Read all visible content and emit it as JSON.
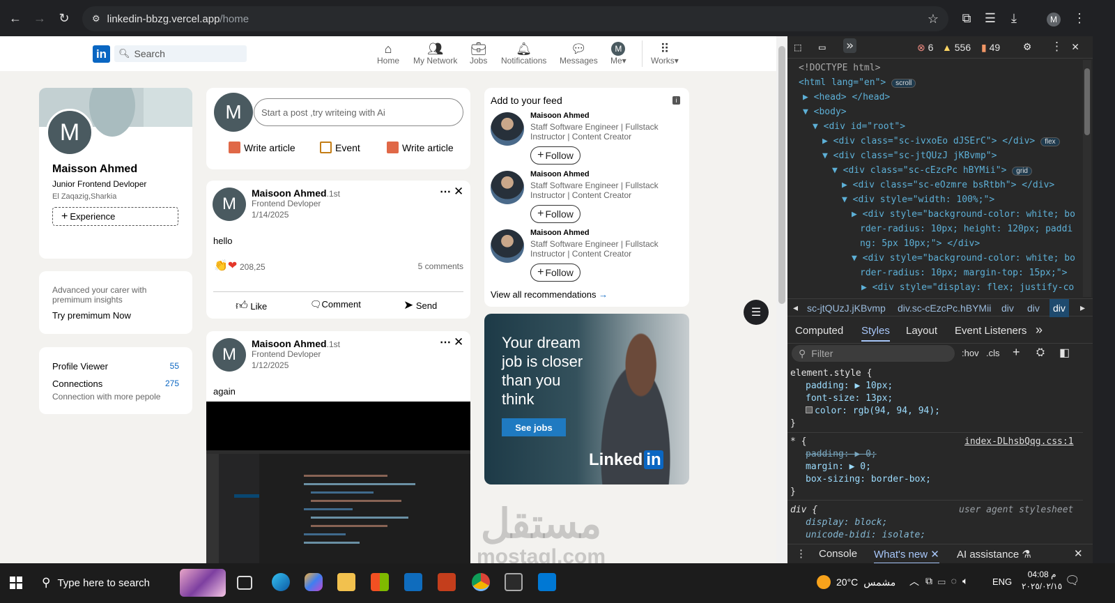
{
  "browser": {
    "url_host": "linkedin-bbzg.vercel.app",
    "url_path": "/home",
    "profile_initial": "M"
  },
  "header": {
    "logo": "in",
    "search_placeholder": "Search",
    "nav": [
      {
        "label": "Home",
        "icon": "home-icon"
      },
      {
        "label": "My Network",
        "icon": "network-icon"
      },
      {
        "label": "Jobs",
        "icon": "briefcase-icon"
      },
      {
        "label": "Notifications",
        "icon": "bell-icon"
      },
      {
        "label": "Messages",
        "icon": "chat-icon"
      },
      {
        "label": "Me",
        "icon": "avatar"
      },
      {
        "label": "Works",
        "icon": "grid-icon"
      }
    ],
    "me_initial": "M"
  },
  "profile": {
    "initial": "M",
    "name": "Maisson Ahmed",
    "title": "Junior Frontend Devloper",
    "location": "El Zaqazig,Sharkia",
    "experience_button": "Experience"
  },
  "premium": {
    "text": "Advanced your carer with premimum insights",
    "link": "Try premimum Now"
  },
  "stats": {
    "profile_viewer_label": "Profile Viewer",
    "profile_viewer_value": "55",
    "connections_label": "Connections",
    "connections_value": "275",
    "connections_sub": "Connection with more pepole"
  },
  "composer": {
    "initial": "M",
    "placeholder": "Start a post ,try writeing with Ai",
    "actions": [
      "Write article",
      "Event",
      "Write article"
    ]
  },
  "posts": [
    {
      "initial": "M",
      "author": "Maisoon Ahmed",
      "degree": ".1st",
      "role": "Frontend Devloper",
      "date": "1/14/2025",
      "text": "hello",
      "reactions": "208,25",
      "comments": "5 comments",
      "actions": [
        "Like",
        "Comment",
        "Send"
      ]
    },
    {
      "initial": "M",
      "author": "Maisoon Ahmed",
      "degree": ".1st",
      "role": "Frontend Devloper",
      "date": "1/12/2025",
      "text": "again"
    }
  ],
  "feed": {
    "title": "Add to your feed",
    "recommendations": [
      {
        "name": "Maisoon Ahmed",
        "headline1": "Staff Software Engineer | Fullstack",
        "headline2": "Instructor | Content Creator",
        "button": "Follow"
      },
      {
        "name": "Maisoon Ahmed",
        "headline1": "Staff Software Engineer | Fullstack",
        "headline2": "Instructor | Content Creator",
        "button": "Follow"
      },
      {
        "name": "Maisoon Ahmed",
        "headline1": "Staff Software Engineer | Fullstack",
        "headline2": "Instructor | Content Creator",
        "button": "Follow"
      }
    ],
    "view_all": "View all recommendations"
  },
  "ad": {
    "line1": "Your dream",
    "line2": "job is closer",
    "line3": "than you",
    "line4": "think",
    "button": "See jobs",
    "brand": "Linked"
  },
  "devtools": {
    "errors": "6",
    "warnings": "556",
    "issues": "49",
    "tree": [
      "<!DOCTYPE html>",
      "<html lang=\"en\">",
      "<head> </head>",
      "<body>",
      "<div id=\"root\">",
      "<div class=\"sc-ivxoEo dJSErC\"> </div>",
      "<div class=\"sc-jtQUzJ jKBvmp\">",
      "<div class=\"sc-cEzcPc hBYMii\">",
      "<div class=\"sc-eOzmre bsRtbh\"> </div>",
      "<div style=\"width: 100%;\">",
      "<div style=\"background-color: white; bo",
      "rder-radius: 10px; height: 120px; paddi",
      "ng: 5px 10px;\"> </div>",
      "<div style=\"background-color: white; bo",
      "rder-radius: 10px; margin-top: 15px;\">",
      "<div style=\"display: flex; justify-co"
    ],
    "badges": {
      "scroll": "scroll",
      "flex": "flex",
      "grid": "grid"
    },
    "breadcrumbs": [
      "sc-jtQUzJ.jKBvmp",
      "div.sc-cEzcPc.hBYMii",
      "div",
      "div",
      "div"
    ],
    "panel_tabs": [
      "Computed",
      "Styles",
      "Layout",
      "Event Listeners"
    ],
    "filter_placeholder": "Filter",
    "filter_tools": [
      ":hov",
      ".cls"
    ],
    "styles": {
      "element_selector": "element.style {",
      "element_rules": [
        "padding: ▶ 10px;",
        "font-size: 13px;",
        "color: rgb(94, 94, 94);"
      ],
      "star_selector": "* {",
      "star_source": "index-DLhsbQqg.css:1",
      "star_rules": [
        "padding: ▶ 0;",
        "margin: ▶ 0;",
        "box-sizing: border-box;"
      ],
      "div_selector": "div {",
      "div_source": "user agent stylesheet",
      "div_rules": [
        "display: block;",
        "unicode-bidi: isolate;"
      ],
      "close_brace": "}"
    },
    "drawer_tabs": [
      "Console",
      "What's new",
      "AI assistance"
    ]
  },
  "taskbar": {
    "search_placeholder": "Type here to search",
    "weather": "20°C",
    "weather_label": "مشمس",
    "language": "ENG",
    "time": "04:08 م",
    "date": "٢٠٢٥/٠٢/١٥"
  },
  "watermark": {
    "text1": "مستقل",
    "text2": "mostaql.com"
  },
  "colors": {
    "linkedin_blue": "#0a66c2",
    "devtools_bg": "#282828",
    "error": "#f28b82",
    "warning": "#fdd663"
  }
}
